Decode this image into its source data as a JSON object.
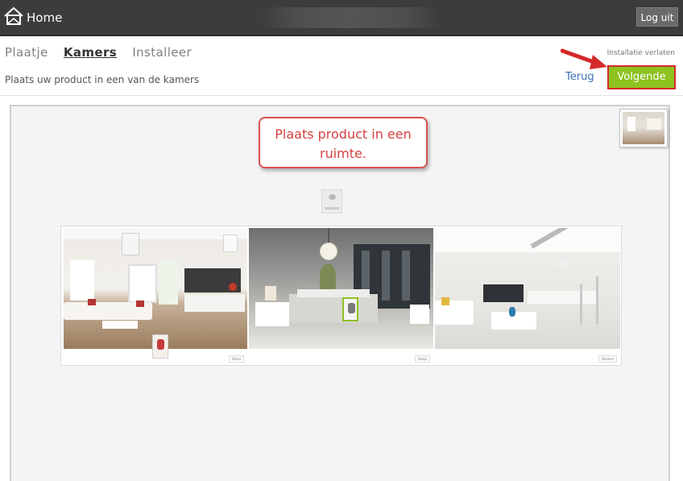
{
  "topbar": {
    "home_label": "Home",
    "logout_label": "Log uit"
  },
  "steps": [
    {
      "label": "Plaatje",
      "active": false
    },
    {
      "label": "Kamers",
      "active": true
    },
    {
      "label": "Installeer",
      "active": false
    }
  ],
  "subtitle": "Plaats uw product in een van de kamers",
  "leave_link": "Installatie verlaten",
  "nav": {
    "back_label": "Terug",
    "next_label": "Volgende"
  },
  "tooltip": {
    "line1": "Plaats product in een",
    "line2": "ruimte."
  },
  "rooms": [
    {
      "caption": "Woon"
    },
    {
      "caption": "Slaap"
    },
    {
      "caption": "Keuken"
    }
  ],
  "colors": {
    "topbar": "#3c3c3c",
    "next_button": "#8dc21f",
    "highlight": "#d42a2a",
    "link": "#3a6fb5"
  },
  "icons": {
    "home": "house-icon",
    "arrow": "red-arrow-icon"
  }
}
